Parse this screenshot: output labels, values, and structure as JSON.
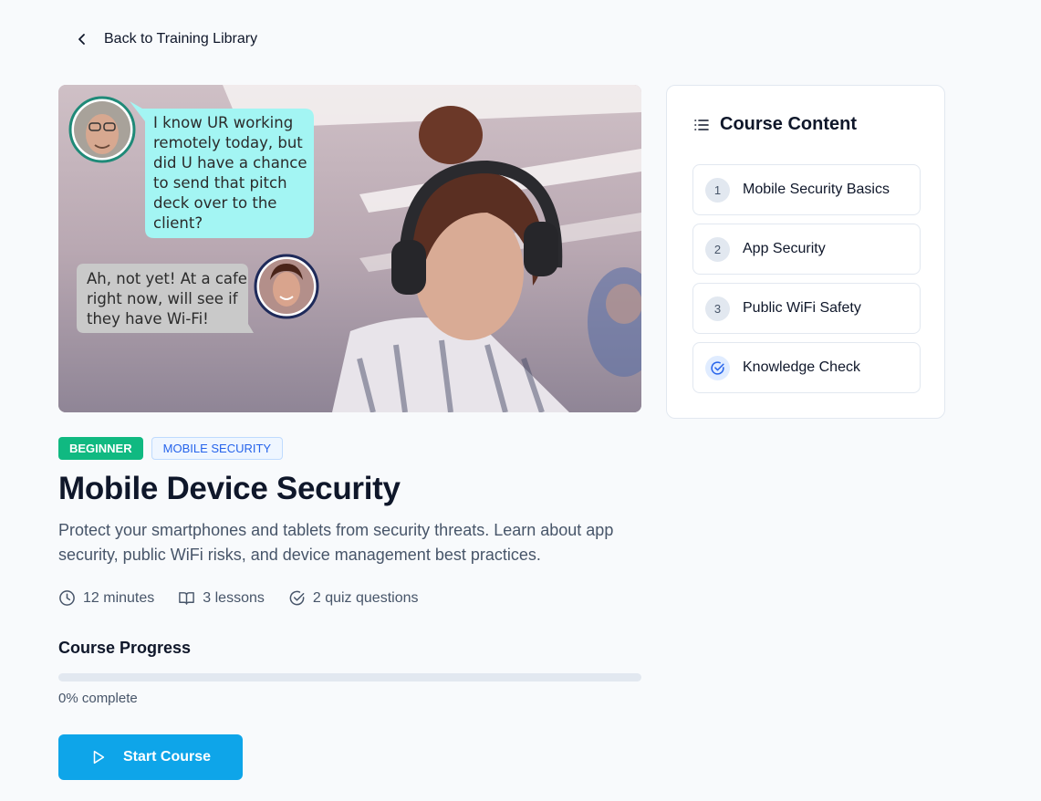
{
  "nav": {
    "back_label": "Back to Training Library"
  },
  "hero": {
    "bubble_1": "I know UR working remotely today, but did U have a chance to send that pitch deck over to the client?",
    "bubble_2": "Ah, not yet! At a cafe right now, will see if they have Wi-Fi!"
  },
  "course": {
    "level_tag": "BEGINNER",
    "category_tag": "MOBILE SECURITY",
    "title": "Mobile Device Security",
    "description": "Protect your smartphones and tablets from security threats. Learn about app security, public WiFi risks, and device management best practices.",
    "meta": {
      "duration": "12 minutes",
      "lessons": "3 lessons",
      "quiz": "2 quiz questions"
    }
  },
  "progress": {
    "label": "Course Progress",
    "percent": 0,
    "text": "0% complete"
  },
  "actions": {
    "start_label": "Start Course"
  },
  "sidebar": {
    "title": "Course Content",
    "items": [
      {
        "num": "1",
        "label": "Mobile Security Basics"
      },
      {
        "num": "2",
        "label": "App Security"
      },
      {
        "num": "3",
        "label": "Public WiFi Safety"
      },
      {
        "num": "",
        "label": "Knowledge Check",
        "icon": "check-circle-icon"
      }
    ]
  },
  "colors": {
    "accent": "#0ea5e9",
    "level_tag": "#10b981",
    "category_tag_text": "#2563eb"
  }
}
